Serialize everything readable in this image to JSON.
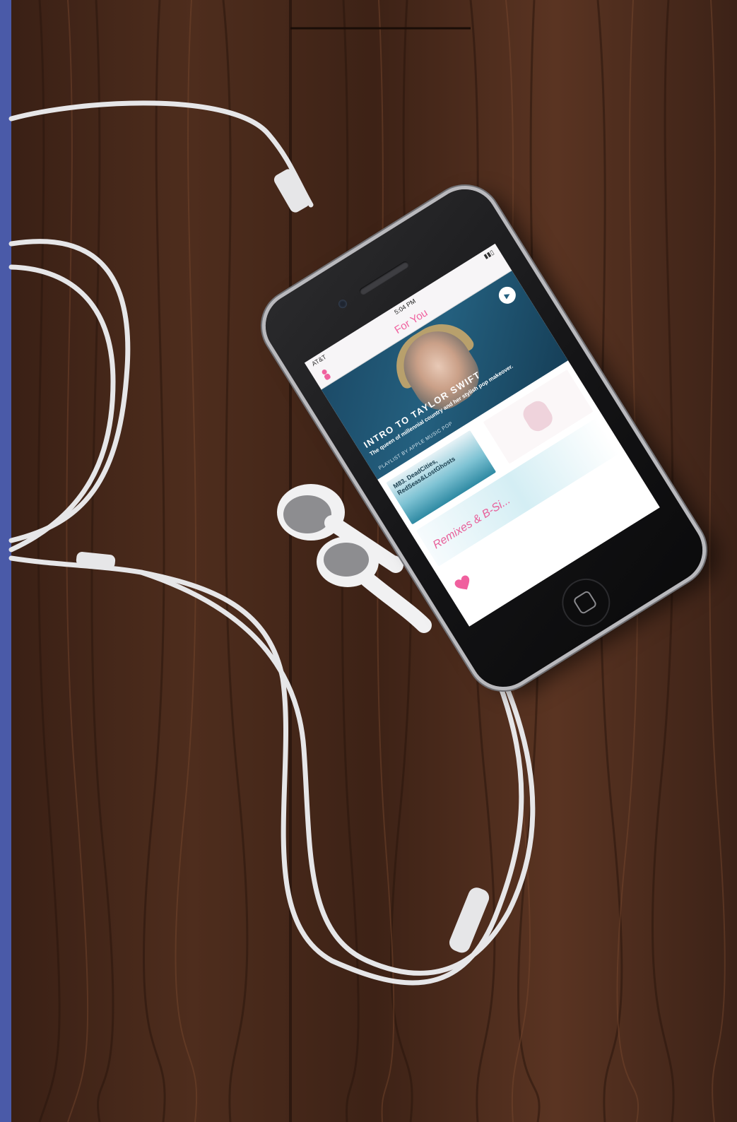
{
  "colors": {
    "edge_strip": "#4a5aa8",
    "wood_dark": "#3b2216",
    "wood_light": "#6b3f28",
    "cable": "#e9e9ea",
    "phone_body": "#141416",
    "accent_pink": "#f0609e",
    "hero_blue": "#24607f"
  },
  "phone": {
    "status": {
      "left": "AT&T",
      "time": "5:04 PM"
    },
    "nav_title": "For You",
    "icons": [
      "profile-icon",
      "play-icon",
      "heart-icon",
      "home-button-icon"
    ],
    "hero": {
      "title": "INTRO TO TAYLOR SWIFT",
      "subtitle": "The queen of millennial country and her stylish pop makeover.",
      "meta": "PLAYLIST BY APPLE MUSIC POP"
    },
    "cards": [
      {
        "text": "M83. DeadCities, RedSeas&LostGhosts"
      },
      {
        "text": ""
      },
      {
        "text": "Remixes & B-Si..."
      }
    ]
  }
}
